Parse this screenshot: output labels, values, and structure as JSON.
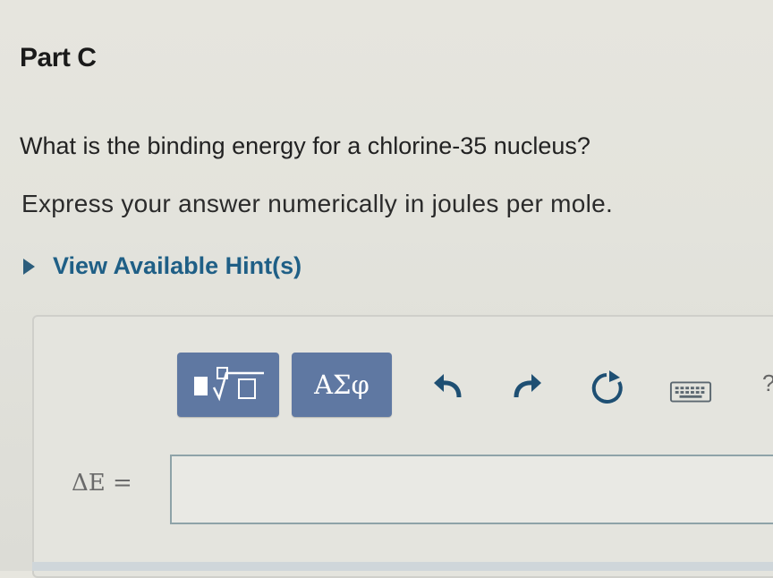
{
  "part": {
    "title": "Part C"
  },
  "question": {
    "text": "What is the binding energy for a chlorine-35 nucleus?",
    "instruction": "Express your answer numerically in joules per mole."
  },
  "hint": {
    "label": "View Available Hint(s)"
  },
  "toolbar": {
    "templates_icon": "templates-radical-icon",
    "symbols_label": "ΑΣφ",
    "undo_icon": "undo-icon",
    "redo_icon": "redo-icon",
    "reset_icon": "reset-icon",
    "keyboard_icon": "keyboard-icon",
    "help_label": "?"
  },
  "answer": {
    "label": "ΔE =",
    "value": ""
  },
  "colors": {
    "button_bg": "#5f78a2",
    "link": "#1f5f86",
    "arrow_icon": "#1e4f73"
  }
}
